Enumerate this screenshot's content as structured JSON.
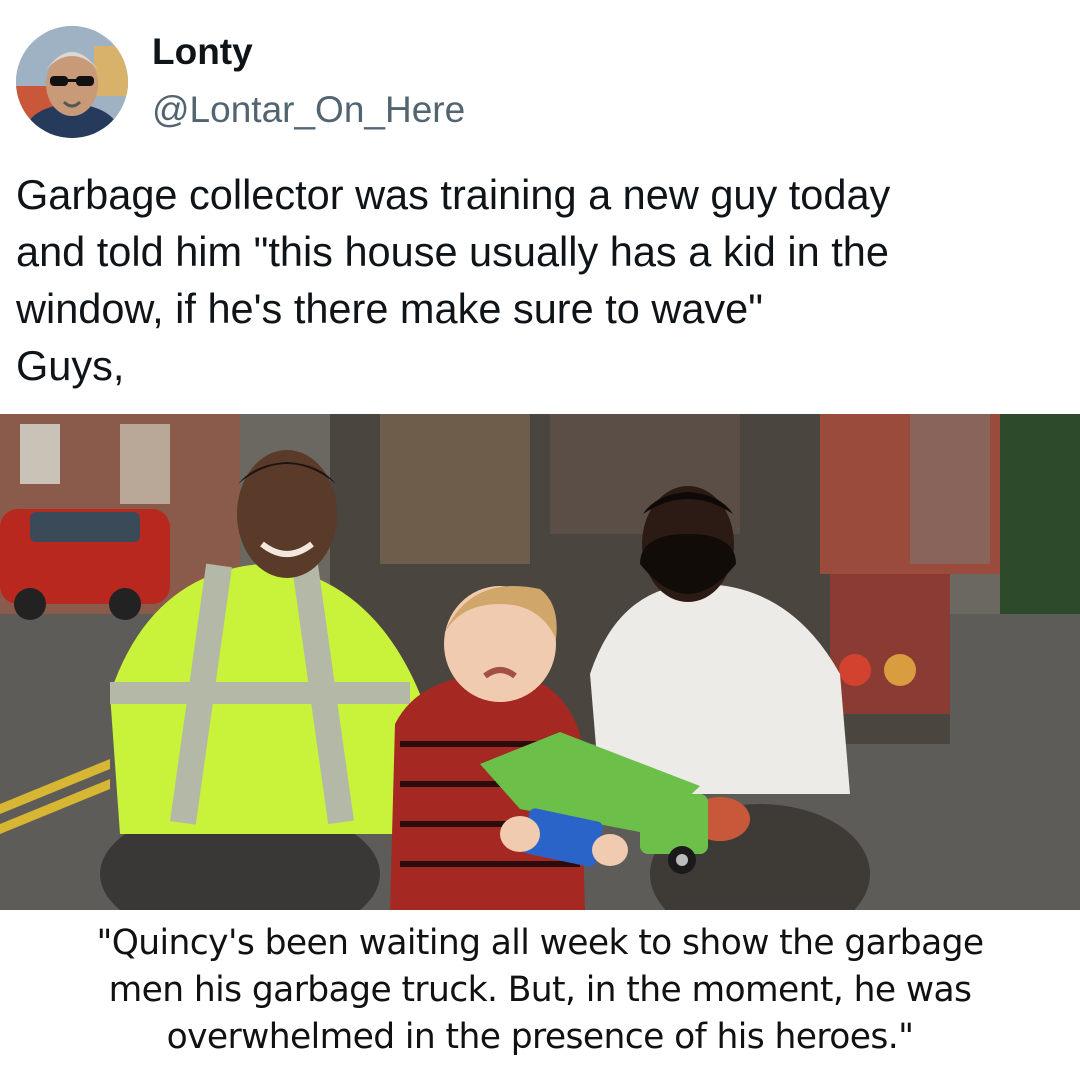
{
  "tweet": {
    "author": {
      "display_name": "Lonty",
      "handle": "@Lontar_On_Here",
      "avatar_icon": "profile-photo-avatar"
    },
    "text": "Garbage collector was training a new guy today\nand told him \"this house usually has a kid in the\nwindow, if he's there make sure to wave\"\nGuys,"
  },
  "photo": {
    "caption": "\"Quincy's been waiting all week to show the garbage\nmen his garbage truck. But, in the moment, he was\noverwhelmed in the presence of his heroes.\""
  },
  "colors": {
    "text_primary": "#0f1419",
    "text_secondary": "#536471",
    "background": "#ffffff",
    "safety_vest": "#c9f23a",
    "toy_truck": "#6cc04a"
  }
}
